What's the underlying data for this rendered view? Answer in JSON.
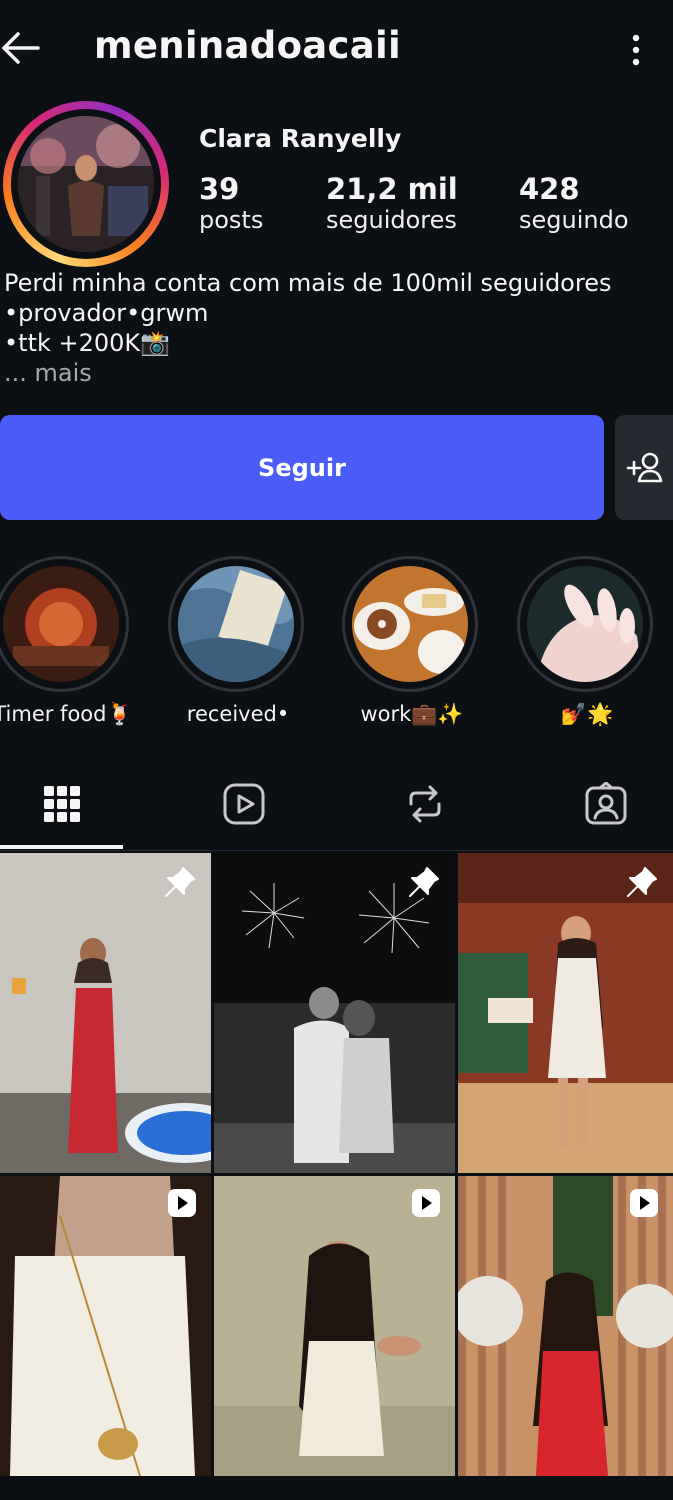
{
  "header": {
    "username": "meninadoacaii"
  },
  "profile": {
    "full_name": "Clara Ranyelly",
    "stats": [
      {
        "value": "39",
        "label": "posts"
      },
      {
        "value": "21,2 mil",
        "label": "seguidores"
      },
      {
        "value": "428",
        "label": "seguindo"
      }
    ],
    "bio": [
      "Perdi minha conta com mais de 100mil seguidores",
      "•provador•grwm",
      "•ttk +200K📸"
    ],
    "bio_more": "... mais"
  },
  "actions": {
    "follow_label": "Seguir"
  },
  "highlights": [
    {
      "label": "Timer food🍹"
    },
    {
      "label": "received•"
    },
    {
      "label": "work💼✨"
    },
    {
      "label": "💅🌟"
    }
  ],
  "tabs": [
    {
      "icon": "grid-icon"
    },
    {
      "icon": "reels-icon"
    },
    {
      "icon": "repost-icon"
    },
    {
      "icon": "tagged-icon"
    }
  ],
  "posts": [
    {
      "badge": "pin-icon"
    },
    {
      "badge": "pin-icon"
    },
    {
      "badge": "pin-icon"
    },
    {
      "badge": "reel-icon"
    },
    {
      "badge": "reel-icon"
    },
    {
      "badge": "reel-icon"
    }
  ],
  "colors": {
    "background": "#0c0f14",
    "follow_button": "#4a5df9",
    "secondary_button": "#262a30"
  }
}
